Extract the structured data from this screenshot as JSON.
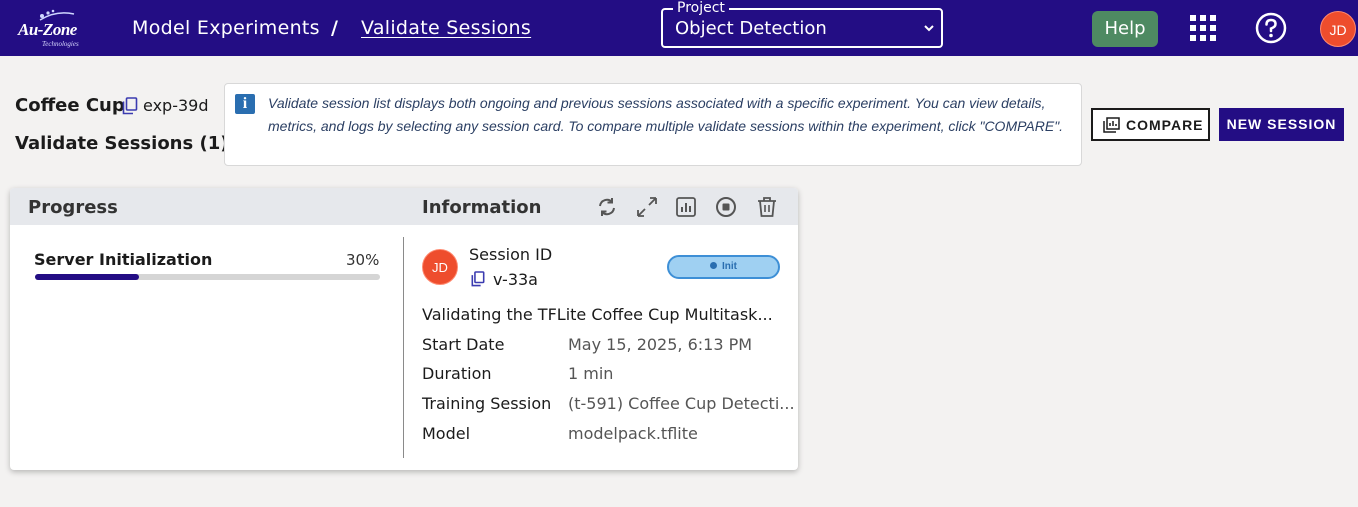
{
  "brand": {
    "logo_text": "Au-Zone",
    "logo_sub": "Technologies"
  },
  "breadcrumb": {
    "parent": "Model Experiments",
    "separator": "/",
    "current": "Validate Sessions"
  },
  "project": {
    "label": "Project",
    "value": "Object Detection"
  },
  "topbar": {
    "help_label": "Help",
    "user_initials": "JD"
  },
  "experiment": {
    "name": "Coffee Cup",
    "id": "exp-39d",
    "sessions_title": "Validate Sessions (1)"
  },
  "info": {
    "icon_glyph": "i",
    "text": "Validate session list displays both ongoing and previous sessions associated with a specific experiment. You can view details, metrics, and logs by selecting any session card. To compare multiple validate sessions within the experiment, click \"COMPARE\"."
  },
  "actions": {
    "compare_label": "COMPARE",
    "new_session_label": "NEW SESSION"
  },
  "card": {
    "progress_header": "Progress",
    "info_header": "Information",
    "stage": {
      "name": "Server Initialization",
      "percent_label": "30%",
      "percent": 30
    },
    "session": {
      "initials": "JD",
      "id_label": "Session ID",
      "id_value": "v-33a",
      "status": "Init",
      "description": "Validating the TFLite Coffee Cup Multitask..."
    },
    "details": [
      {
        "label": "Start Date",
        "value": "May 15, 2025, 6:13 PM"
      },
      {
        "label": "Duration",
        "value": "1 min"
      },
      {
        "label": "Training Session",
        "value": "(t-591) Coffee Cup Detecti..."
      },
      {
        "label": "Model",
        "value": "modelpack.tflite"
      }
    ]
  },
  "colors": {
    "primary": "#230d84",
    "help": "#4e8a62",
    "avatar": "#ee4d2d",
    "status": "#2a6eb0"
  },
  "icons": [
    "copy-icon",
    "chevron-down-icon",
    "apps-grid-icon",
    "help-circle-icon",
    "refresh-icon",
    "expand-icon",
    "chart-icon",
    "stop-icon",
    "trash-icon",
    "compare-icon",
    "info-icon"
  ]
}
